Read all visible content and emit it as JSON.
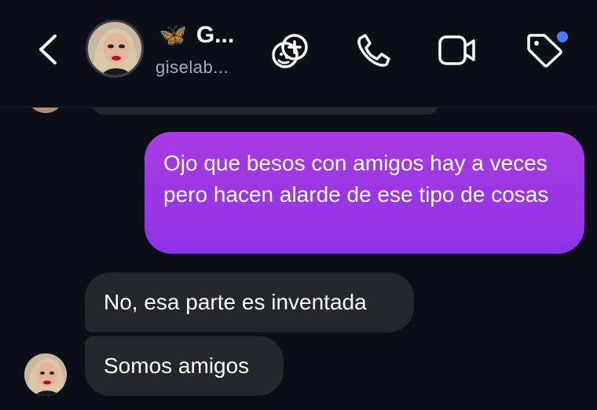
{
  "header": {
    "back_icon": "chevron-left-icon",
    "contact_emoji": "🦋",
    "contact_name": "G...",
    "contact_username": "giselab...",
    "actions": [
      {
        "name": "effects-icon"
      },
      {
        "name": "phone-icon"
      },
      {
        "name": "video-camera-icon"
      },
      {
        "name": "tag-icon"
      }
    ],
    "notification_dot_color": "#4b7bff"
  },
  "messages": [
    {
      "direction": "outgoing",
      "text": "Ojo que besos con amigos hay a veces pero hacen alarde de ese tipo de cosas"
    },
    {
      "direction": "incoming",
      "text": "No, esa parte es inventada"
    },
    {
      "direction": "incoming",
      "text": "Somos amigos"
    }
  ],
  "colors": {
    "background": "#0c0f15",
    "outgoing_bubble_top": "#a93be2",
    "outgoing_bubble_bottom": "#8f32e8",
    "incoming_bubble": "#26272d"
  }
}
